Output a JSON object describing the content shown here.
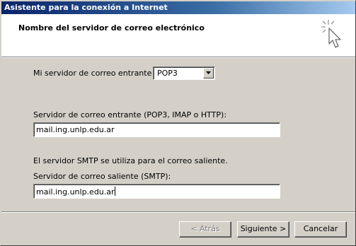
{
  "window": {
    "title": "Asistente para la conexión a Internet"
  },
  "header": {
    "heading": "Nombre del servidor de correo electrónico",
    "icon": "wizard-cursor-icon"
  },
  "form": {
    "incoming_type_label": "Mi servidor de correo entrante es",
    "incoming_type_value": "POP3",
    "incoming_server_label": "Servidor de correo entrante (POP3, IMAP o HTTP):",
    "incoming_server_value": "mail.ing.unlp.edu.ar",
    "smtp_note": "El servidor SMTP se utiliza para el correo saliente.",
    "outgoing_server_label": "Servidor de correo saliente (SMTP):",
    "outgoing_server_value": "mail.ing.unlp.edu.ar"
  },
  "buttons": {
    "back": "< Atrás",
    "next": "Siguiente >",
    "cancel": "Cancelar"
  }
}
